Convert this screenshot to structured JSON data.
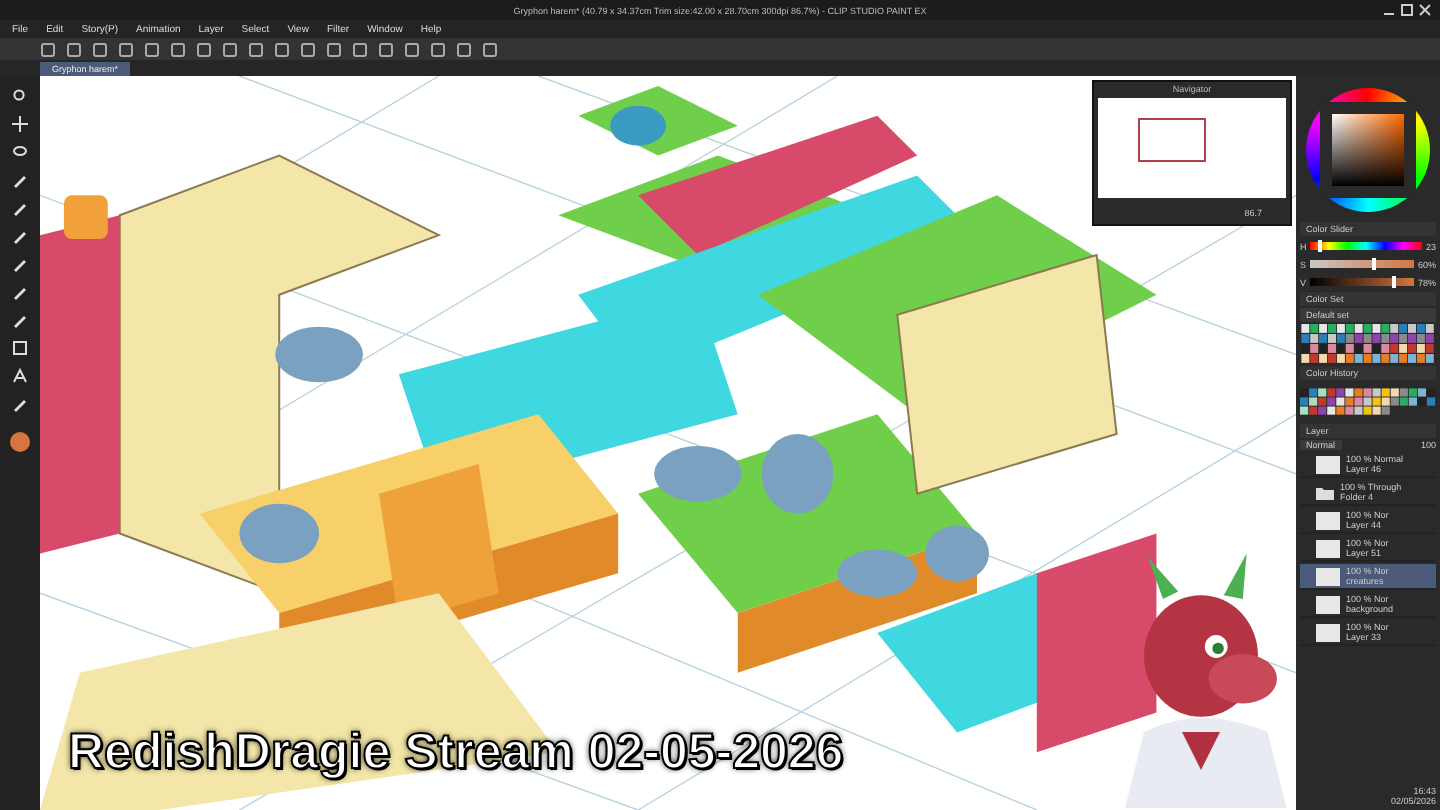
{
  "window": {
    "title": "Gryphon harem* (40.79 x 34.37cm Trim size:42.00 x 28.70cm 300dpi 86.7%) - CLIP STUDIO PAINT EX"
  },
  "menu": [
    "File",
    "Edit",
    "Story(P)",
    "Animation",
    "Layer",
    "Select",
    "View",
    "Filter",
    "Window",
    "Help"
  ],
  "document_tab": {
    "label": "Gryphon harem*"
  },
  "navigator": {
    "title": "Navigator",
    "zoom": "86.7"
  },
  "color_slider": {
    "title": "Color Slider",
    "rows": [
      {
        "label": "H",
        "value": "23",
        "level": 0.06
      },
      {
        "label": "S",
        "value": "60%",
        "level": 0.6
      },
      {
        "label": "V",
        "value": "78%",
        "level": 0.78
      }
    ]
  },
  "color_set": {
    "title": "Color Set",
    "preset": "Default set"
  },
  "color_history": {
    "title": "Color History"
  },
  "layer_panel": {
    "title": "Layer",
    "blend_mode": "Normal",
    "opacity": "100",
    "layers": [
      {
        "kind": "layer",
        "mode": "100 % Normal",
        "name": "Layer 46",
        "selected": false
      },
      {
        "kind": "folder",
        "mode": "100 % Through",
        "name": "Folder 4",
        "selected": false
      },
      {
        "kind": "layer",
        "mode": "100 % Nor",
        "name": "Layer 44",
        "selected": false
      },
      {
        "kind": "layer",
        "mode": "100 % Nor",
        "name": "Layer 51",
        "selected": false
      },
      {
        "kind": "layer",
        "mode": "100 % Nor",
        "name": "creatures",
        "selected": true
      },
      {
        "kind": "layer",
        "mode": "100 % Nor",
        "name": "background",
        "selected": false
      },
      {
        "kind": "layer",
        "mode": "100 % Nor",
        "name": "Layer 33",
        "selected": false
      }
    ]
  },
  "clock": {
    "time": "16:43",
    "date": "02/05/2026"
  },
  "caption": "RedishDragie Stream 02-05-2026"
}
